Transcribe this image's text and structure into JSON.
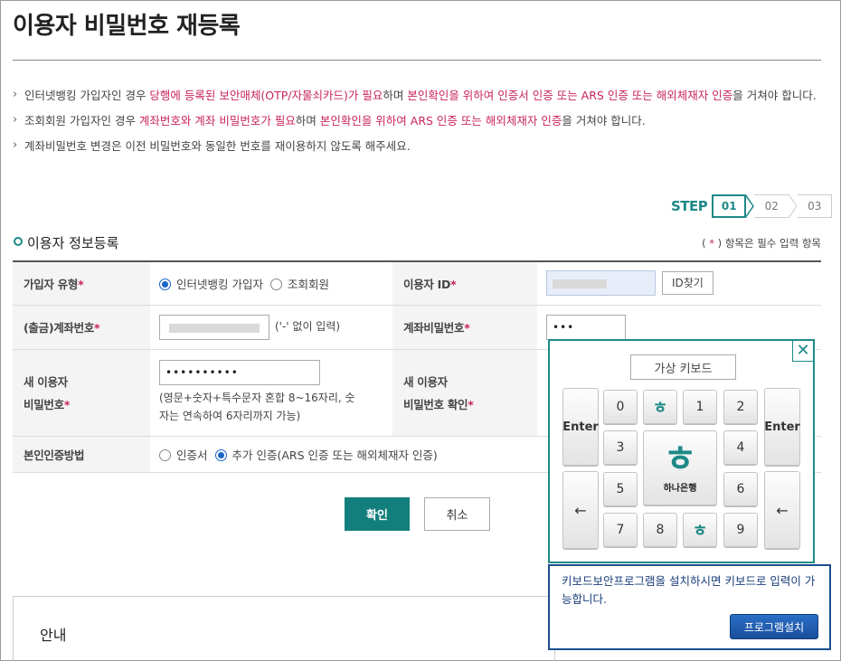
{
  "page": {
    "title": "이용자 비밀번호 재등록"
  },
  "notes": {
    "n1_a": "인터넷뱅킹 가입자인 경우 ",
    "n1_b": "당행에 등록된 보안매체(OTP/자물쇠카드)가 필요",
    "n1_c": "하며 ",
    "n1_d": "본인확인을 위하여 인증서 인증 또는 ARS 인증 또는 해외체재자 인증",
    "n1_e": "을 거쳐야 합니다.",
    "n2_a": "조회회원 가입자인 경우 ",
    "n2_b": "계좌번호와 계좌 비밀번호가 필요",
    "n2_c": "하며 ",
    "n2_d": "본인확인을 위하여 ARS 인증 또는 해외체재자 인증",
    "n2_e": "을 거쳐야 합니다.",
    "n3": "계좌비밀번호 변경은 이전 비밀번호와 동일한 번호를 재이용하지 않도록 해주세요."
  },
  "steps": {
    "label": "STEP",
    "items": [
      "01",
      "02",
      "03"
    ],
    "active": "01"
  },
  "section": {
    "title": "이용자 정보등록",
    "req_open": "( ",
    "req_star": "*",
    "req_close": " ) 항목은 필수 입력 항목"
  },
  "form": {
    "required_mark": "*",
    "user_type_label": "가입자 유형",
    "user_type_opt1": "인터넷뱅킹 가입자",
    "user_type_opt2": "조회회원",
    "user_id_label": "이용자 ID",
    "find_id_button": "ID찾기",
    "account_label": "(출금)계좌번호",
    "account_hint": "('-' 없이 입력)",
    "account_pw_label": "계좌비밀번호",
    "account_pw_value": "•••",
    "new_pw_label_1": "새 이용자",
    "new_pw_label_2": "비밀번호",
    "new_pw_value": "••••••••••",
    "new_pw_help_1": "(영문+숫자+특수문자 혼합 8~16자리, 숫",
    "new_pw_help_2": "자는 연속하여 6자리까지 가능)",
    "confirm_pw_label_1": "새 이용자",
    "confirm_pw_label_2": "비밀번호 확인",
    "auth_label": "본인인증방법",
    "auth_opt1": "인증서",
    "auth_opt2": "추가 인증(ARS 인증 또는 해외체재자 인증)"
  },
  "buttons": {
    "confirm": "확인",
    "cancel": "취소"
  },
  "info": {
    "title": "안내"
  },
  "keyboard": {
    "title": "가상 키보드",
    "enter": "Enter",
    "backspace": "←",
    "close": "✕",
    "logo_text": "하나은행",
    "logo_mark": "ㅎ",
    "keys": [
      "0",
      "1",
      "2",
      "3",
      "4",
      "5",
      "6",
      "7",
      "8",
      "9"
    ],
    "notice": "키보드보안프로그램을 설치하시면 키보드로 입력이 가능합니다.",
    "install_button": "프로그램설치"
  },
  "colors": {
    "brand": "#1e8a88",
    "highlight": "#c8245f",
    "radio_on": "#1a64c8"
  }
}
